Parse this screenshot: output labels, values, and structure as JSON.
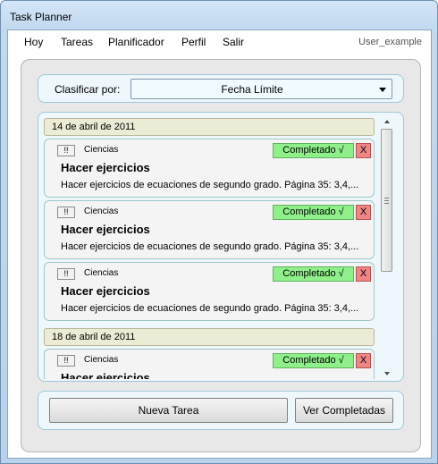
{
  "window": {
    "title": "Task Planner"
  },
  "menu": {
    "items": [
      "Hoy",
      "Tareas",
      "Planificador",
      "Perfil",
      "Salir"
    ],
    "user": "User_example"
  },
  "sort": {
    "label": "Clasificar por:",
    "value": "Fecha Límite"
  },
  "groups": [
    {
      "date": "14 de abril de 2011",
      "tasks": [
        {
          "priority": "!!",
          "category": "Ciencias",
          "title": "Hacer ejercicios",
          "description": "Hacer ejercicios de ecuaciones de segundo grado. Página 35: 3,4,...",
          "done_label": "Completado √",
          "delete_label": "X"
        },
        {
          "priority": "!!",
          "category": "Ciencias",
          "title": "Hacer ejercicios",
          "description": "Hacer ejercicios de ecuaciones de segundo grado. Página 35: 3,4,...",
          "done_label": "Completado √",
          "delete_label": "X"
        },
        {
          "priority": "!!",
          "category": "Ciencias",
          "title": "Hacer ejercicios",
          "description": "Hacer ejercicios de ecuaciones de segundo grado. Página 35: 3,4,...",
          "done_label": "Completado √",
          "delete_label": "X"
        }
      ]
    },
    {
      "date": "18 de abril de 2011",
      "tasks": [
        {
          "priority": "!!",
          "category": "Ciencias",
          "title": "Hacer ejercicios",
          "description": "",
          "done_label": "Completado √",
          "delete_label": "X"
        }
      ]
    }
  ],
  "buttons": {
    "new_task": "Nueva Tarea",
    "view_completed": "Ver Completadas"
  },
  "colors": {
    "complete_button": "#8ff08a",
    "delete_button": "#ef8585",
    "date_header": "#ecebd5",
    "panel": "#eef7fb"
  }
}
